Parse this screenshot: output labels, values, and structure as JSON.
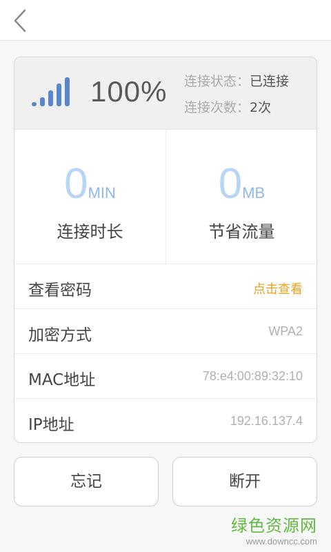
{
  "header": {
    "percent": "100%",
    "status_label": "连接状态：",
    "status_value": "已连接",
    "count_label": "连接次数：",
    "count_value": "2次"
  },
  "stats": [
    {
      "value": "0",
      "unit": "MIN",
      "label": "连接时长"
    },
    {
      "value": "0",
      "unit": "MB",
      "label": "节省流量"
    }
  ],
  "rows": [
    {
      "label": "查看密码",
      "value": "点击查看"
    },
    {
      "label": "加密方式",
      "value": "WPA2"
    },
    {
      "label": "MAC地址",
      "value": "78:e4:00:89:32:10"
    },
    {
      "label": "IP地址",
      "value": "192.16.137.4"
    }
  ],
  "buttons": {
    "forget": "忘记",
    "disconnect": "断开"
  },
  "watermark": {
    "name": "绿色资源网",
    "url": "www.downcc.com"
  },
  "colors": {
    "accent_link": "#f0a020",
    "stat_number": "#b8d4f6",
    "signal_bars": "#5b86c9",
    "watermark": "#60b940"
  },
  "icons": {
    "back": "chevron-left-icon",
    "signal": "wifi-signal-icon"
  }
}
